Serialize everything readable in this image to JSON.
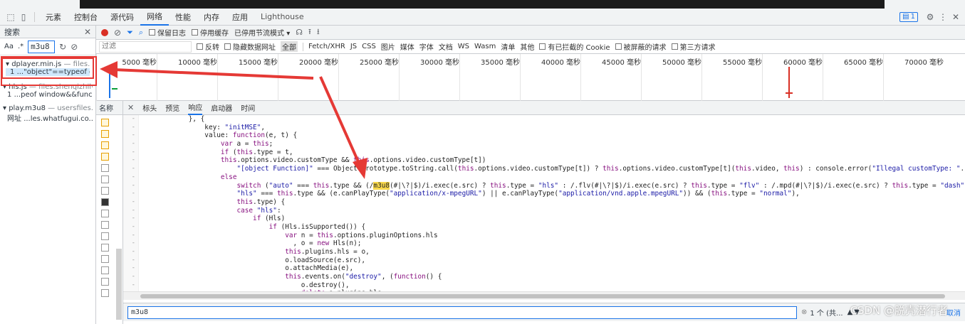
{
  "devtools_tabs": [
    "元素",
    "控制台",
    "源代码",
    "网络",
    "性能",
    "内存",
    "应用",
    "Lighthouse"
  ],
  "active_tab": "网络",
  "issues_badge": "1",
  "search_panel": {
    "title": "搜索",
    "aa_label": "Aa",
    "regex_label": ".*",
    "query": "m3u8",
    "results": [
      {
        "file": "dplayer.min.js",
        "url": "— files.she...",
        "line_no": "1",
        "snippet": "...\"object\"==typeof ex..."
      },
      {
        "file": "hls.js",
        "url": "— files.shenqizhilv.c...",
        "line_no": "1",
        "snippet": "...peof window&&func..."
      },
      {
        "file": "play.m3u8",
        "url": "— usersfiles.w...",
        "line_no": "网址",
        "snippet": "...les.whatfugui.co..."
      }
    ]
  },
  "network_toolbar": {
    "preserve_log": "保留日志",
    "disable_cache": "停用缓存",
    "throttling": "已停用节流模式"
  },
  "filter_bar": {
    "placeholder": "过滤",
    "invert": "反转",
    "hide_data_urls": "隐藏数据网址",
    "types": [
      "全部",
      "Fetch/XHR",
      "JS",
      "CSS",
      "图片",
      "媒体",
      "字体",
      "文档",
      "WS",
      "Wasm",
      "清单",
      "其他"
    ],
    "selected_type": "全部",
    "blocked_cookies": "有已拦截的 Cookie",
    "blocked_requests": "被屏蔽的请求",
    "third_party": "第三方请求"
  },
  "timeline_ticks": [
    "5000 毫秒",
    "10000 毫秒",
    "15000 毫秒",
    "20000 毫秒",
    "25000 毫秒",
    "30000 毫秒",
    "35000 毫秒",
    "40000 毫秒",
    "45000 毫秒",
    "50000 毫秒",
    "55000 毫秒",
    "60000 毫秒",
    "65000 毫秒",
    "70000 毫秒"
  ],
  "request_column_header": "名称",
  "detail_tabs": [
    "标头",
    "预览",
    "响应",
    "启动器",
    "时间"
  ],
  "active_detail_tab": "响应",
  "code_lines": [
    "            }, {",
    "                key: \"initMSE\",",
    "                value: function(e, t) {",
    "                    var a = this;",
    "                    if (this.type = t,",
    "                    this.options.video.customType && this.options.video.customType[t])",
    "                        \"[object Function]\" === Object.prototype.toString.call(this.options.video.customType[t]) ? this.options.video.customType[t](this.video, this) : console.error(\"Illegal customType: \".concat(t));",
    "                    else",
    "                        switch (\"auto\" === this.type && (/m3u8(#|\\?|$)/i.exec(e.src) ? this.type = \"hls\" : /.flv(#|\\?|$)/i.exec(e.src) ? this.type = \"flv\" : /.mpd(#|\\?|$)/i.exec(e.src) ? this.type = \"dash\" : this.typ",
    "                        \"hls\" === this.type && (e.canPlayType(\"application/x-mpegURL\") || e.canPlayType(\"application/vnd.apple.mpegURL\")) && (this.type = \"normal\"),",
    "                        this.type) {",
    "                        case \"hls\":",
    "                            if (Hls)",
    "                                if (Hls.isSupported()) {",
    "                                    var n = this.options.pluginOptions.hls",
    "                                      , o = new Hls(n);",
    "                                    this.plugins.hls = o,",
    "                                    o.loadSource(e.src),",
    "                                    o.attachMedia(e),",
    "                                    this.events.on(\"destroy\", (function() {",
    "                                        o.destroy(),",
    "                                        delete a.plugins.hls"
  ],
  "gutter_mark": "-",
  "find_bar": {
    "query": "m3u8",
    "match_info": "1 个 (共...",
    "cancel": "取消"
  },
  "watermark": "CSDN @脱壳潜行者",
  "colors": {
    "accent": "#1a73e8",
    "highlight": "#f8d84b",
    "annotation_red": "#e53935"
  }
}
